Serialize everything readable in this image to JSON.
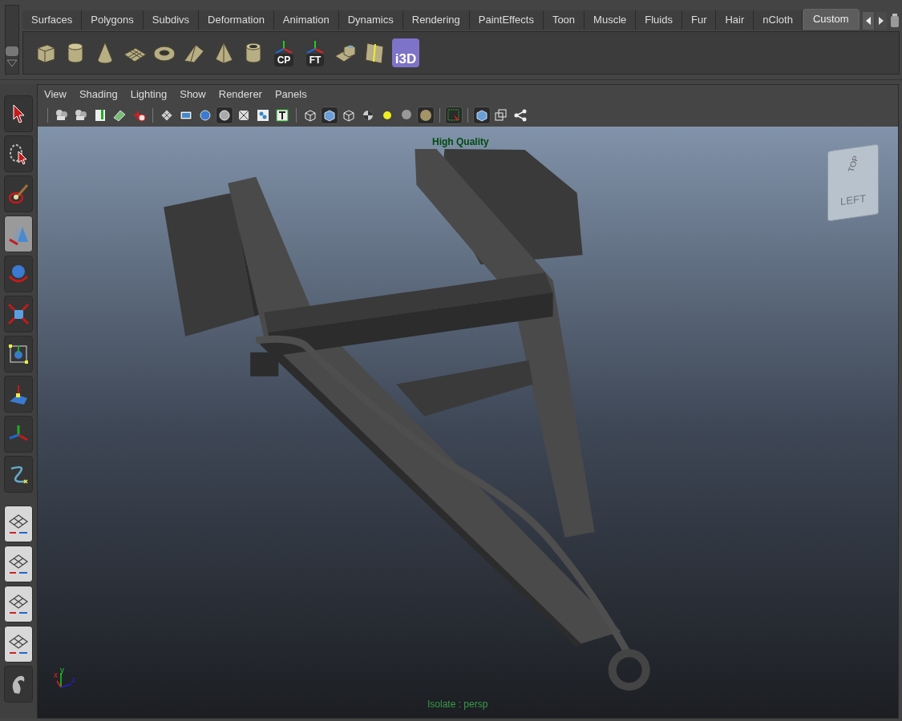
{
  "shelf_tabs": [
    {
      "label": "Surfaces",
      "selected": false
    },
    {
      "label": "Polygons",
      "selected": false
    },
    {
      "label": "Subdivs",
      "selected": false
    },
    {
      "label": "Deformation",
      "selected": false
    },
    {
      "label": "Animation",
      "selected": false
    },
    {
      "label": "Dynamics",
      "selected": false
    },
    {
      "label": "Rendering",
      "selected": false
    },
    {
      "label": "PaintEffects",
      "selected": false
    },
    {
      "label": "Toon",
      "selected": false
    },
    {
      "label": "Muscle",
      "selected": false
    },
    {
      "label": "Fluids",
      "selected": false
    },
    {
      "label": "Fur",
      "selected": false
    },
    {
      "label": "Hair",
      "selected": false
    },
    {
      "label": "nCloth",
      "selected": false
    },
    {
      "label": "Custom",
      "selected": true
    }
  ],
  "shelf_items": [
    {
      "kind": "cube"
    },
    {
      "kind": "cylinder"
    },
    {
      "kind": "cone"
    },
    {
      "kind": "plane"
    },
    {
      "kind": "torus"
    },
    {
      "kind": "prism"
    },
    {
      "kind": "pyramid"
    },
    {
      "kind": "pipe"
    },
    {
      "kind": "axes",
      "label": "CP"
    },
    {
      "kind": "axes",
      "label": "FT"
    },
    {
      "kind": "extrude"
    },
    {
      "kind": "bevel"
    },
    {
      "kind": "logo",
      "label": "i3D"
    }
  ],
  "tools": [
    {
      "kind": "select",
      "selected": false
    },
    {
      "kind": "lasso",
      "selected": false
    },
    {
      "kind": "paint",
      "selected": false
    },
    {
      "kind": "move",
      "selected": true
    },
    {
      "kind": "rotate",
      "selected": false
    },
    {
      "kind": "scale",
      "selected": false
    },
    {
      "kind": "universal",
      "selected": false
    },
    {
      "kind": "softmod",
      "selected": false
    },
    {
      "kind": "manip",
      "selected": false
    },
    {
      "kind": "curve",
      "selected": false
    },
    {
      "kind": "layout",
      "selected": false
    },
    {
      "kind": "layout",
      "selected": false
    },
    {
      "kind": "layout",
      "selected": false
    },
    {
      "kind": "layout",
      "selected": false
    },
    {
      "kind": "logo",
      "selected": false
    }
  ],
  "viewport": {
    "menus": [
      "View",
      "Shading",
      "Lighting",
      "Show",
      "Renderer",
      "Panels"
    ],
    "toolbar_groups": [
      {
        "items": [
          {
            "kind": "camera",
            "selected": false
          },
          {
            "kind": "camera",
            "selected": false
          },
          {
            "kind": "bookmark",
            "selected": false
          },
          {
            "kind": "plane",
            "selected": false
          },
          {
            "kind": "pan",
            "selected": false
          }
        ]
      },
      {
        "items": [
          {
            "kind": "grid",
            "selected": false
          },
          {
            "kind": "film",
            "selected": false
          },
          {
            "kind": "sphere",
            "selected": false
          },
          {
            "kind": "circle",
            "selected": true
          },
          {
            "kind": "cross",
            "selected": false
          },
          {
            "kind": "dots",
            "selected": false
          },
          {
            "kind": "text",
            "selected": false
          }
        ]
      },
      {
        "items": [
          {
            "kind": "wirecube",
            "selected": false
          },
          {
            "kind": "solidcube",
            "selected": true
          },
          {
            "kind": "wirecube",
            "selected": false
          },
          {
            "kind": "checker",
            "selected": false
          },
          {
            "kind": "light",
            "selected": false
          },
          {
            "kind": "greysphere",
            "selected": false
          },
          {
            "kind": "goldsphere",
            "selected": true
          }
        ]
      },
      {
        "items": [
          {
            "kind": "select",
            "selected": true
          }
        ]
      },
      {
        "items": [
          {
            "kind": "solidcube",
            "selected": true
          },
          {
            "kind": "squares",
            "selected": false
          },
          {
            "kind": "share",
            "selected": false
          }
        ]
      }
    ],
    "quality_label": "High Quality",
    "view_cube": {
      "top": "TOP",
      "front": "LEFT"
    },
    "axis": {
      "x": "x",
      "y": "y",
      "z": "z"
    },
    "isolate_label": "Isolate : persp"
  }
}
